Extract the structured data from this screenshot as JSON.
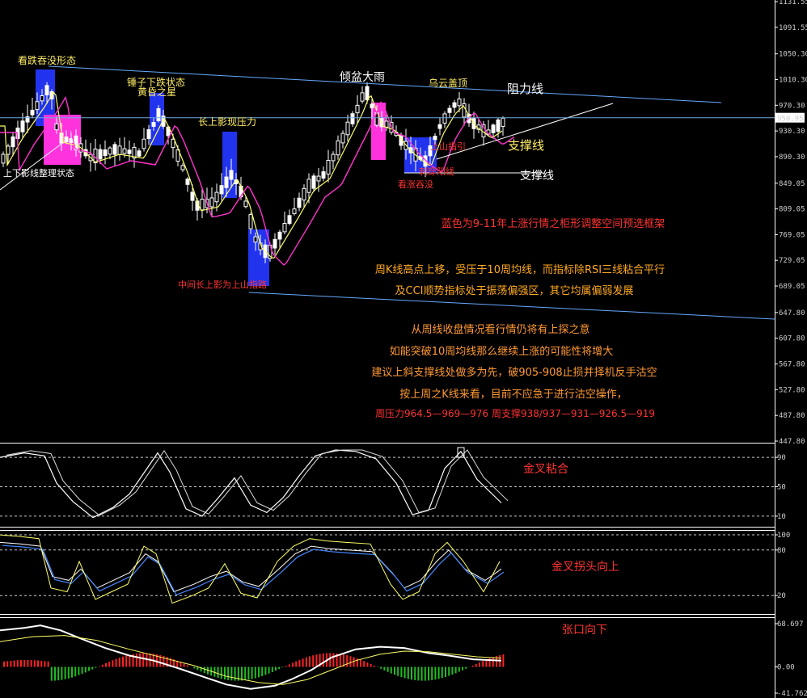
{
  "chart_data": [
    {
      "type": "candlestick",
      "panel": "main",
      "y_ticks": [
        1131.55,
        1091.55,
        1050.3,
        1010.3,
        970.3,
        930.3,
        890.3,
        849.05,
        809.05,
        769.05,
        729.05,
        689.05,
        647.8,
        607.8,
        567.8,
        527.8,
        487.8,
        447.8
      ],
      "ylim": [
        447.8,
        1131.55
      ],
      "last_price": "950.95",
      "last_value": 950.95,
      "ma_colors": {
        "ma_short": "#ffff66",
        "ma_long": "#ff33cc"
      },
      "annotations": [
        {
          "text": "看跌吞没形态",
          "color": "#ffee66"
        },
        {
          "text": "上下影线整理状态",
          "color": "#ffffff"
        },
        {
          "text": "锤子下跌状态",
          "color": "#ffee66"
        },
        {
          "text": "黄昏之星",
          "color": "#ffee66"
        },
        {
          "text": "长上影现压力",
          "color": "#ffee66"
        },
        {
          "text": "中间长上影为上山指路",
          "color": "#ff3333"
        },
        {
          "text": "倾盆大雨",
          "color": "#ffffff"
        },
        {
          "text": "乌云盖顶",
          "color": "#ffee66"
        },
        {
          "text": "阻力线",
          "color": "#ffffff"
        },
        {
          "text": "支撑线",
          "color": "#ffee66"
        },
        {
          "text": "支撑线",
          "color": "#ffffff"
        },
        {
          "text": "上山指引",
          "color": "#ff3333"
        },
        {
          "text": "刺穿阳线",
          "color": "#ff3333"
        },
        {
          "text": "看涨吞没",
          "color": "#ff3333"
        }
      ],
      "commentary": [
        {
          "text": "蓝色为9-11年上涨行情之柜形调整空间预选框架",
          "color": "#ff3333"
        },
        {
          "text": "周K线高点上移，受压于10周均线，而指标除RSI三线粘合平行",
          "color": "#ffaa22"
        },
        {
          "text": "及CCI顺势指标处于振荡偏强区，其它均属偏弱发展",
          "color": "#ffaa22"
        },
        {
          "text": "从周线收盘情况看行情仍将有上探之意",
          "color": "#ff9933"
        },
        {
          "text": "如能突破10周均线那么继续上涨的可能性将增大",
          "color": "#ff9933"
        },
        {
          "text": "建议上斜支撑线处做多为先，破905-908止损并择机反手沽空",
          "color": "#ff9933"
        },
        {
          "text": "按上周之K线来看，目前不应急于进行沽空操作，",
          "color": "#ff9933"
        },
        {
          "text": "周压力964.5—969—976    周支撑938/937—931—926.5—919",
          "color": "#ff3333"
        }
      ]
    },
    {
      "type": "line",
      "panel": "kdj",
      "y_ticks": [
        "90",
        "50",
        "10"
      ],
      "y_values": [
        90,
        50,
        10
      ],
      "ylim": [
        0,
        100
      ],
      "label": {
        "text": "金叉粘合",
        "color": "#ff3333"
      }
    },
    {
      "type": "line",
      "panel": "rsi",
      "y_ticks": [
        "100",
        "80",
        "20"
      ],
      "y_values": [
        100,
        80,
        20
      ],
      "ylim": [
        0,
        100
      ],
      "label": {
        "text": "金叉拐头向上",
        "color": "#ff3333"
      }
    },
    {
      "type": "bar",
      "panel": "macd",
      "y_ticks": [
        "68.697",
        "0.00",
        "-41.762"
      ],
      "y_values": [
        68.697,
        0,
        -41.762
      ],
      "ylim": [
        -41.762,
        68.697
      ],
      "label": {
        "text": "张口向下",
        "color": "#ff3333"
      }
    }
  ]
}
